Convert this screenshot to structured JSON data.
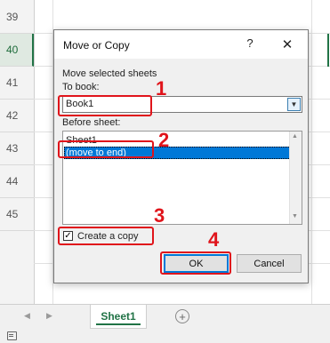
{
  "spreadsheet": {
    "row_numbers": [
      "39",
      "40",
      "41",
      "42",
      "43",
      "44",
      "45"
    ],
    "selected_row": "40",
    "sheet_tab": "Sheet1",
    "add_sheet_symbol": "+",
    "nav_prev": "◀",
    "nav_next": "▶"
  },
  "dialog": {
    "title": "Move or Copy",
    "help_symbol": "?",
    "close_symbol": "✕",
    "move_label": "Move selected sheets",
    "to_book_label": "To book:",
    "to_book_value": "Book1",
    "before_sheet_label": "Before sheet:",
    "sheets": [
      "Sheet1",
      "(move to end)"
    ],
    "selected_sheet": "(move to end)",
    "create_copy_label": "Create a copy",
    "create_copy_checked": true,
    "check_mark": "✓",
    "ok_label": "OK",
    "cancel_label": "Cancel",
    "dropdown_arrow": "▼",
    "scroll_up": "▲",
    "scroll_down": "▼"
  },
  "annotations": {
    "step1": "1",
    "step2": "2",
    "step3": "3",
    "step4": "4",
    "color": "#e0141b"
  },
  "colors": {
    "excel_green": "#217346",
    "selection_blue": "#0078d7"
  }
}
